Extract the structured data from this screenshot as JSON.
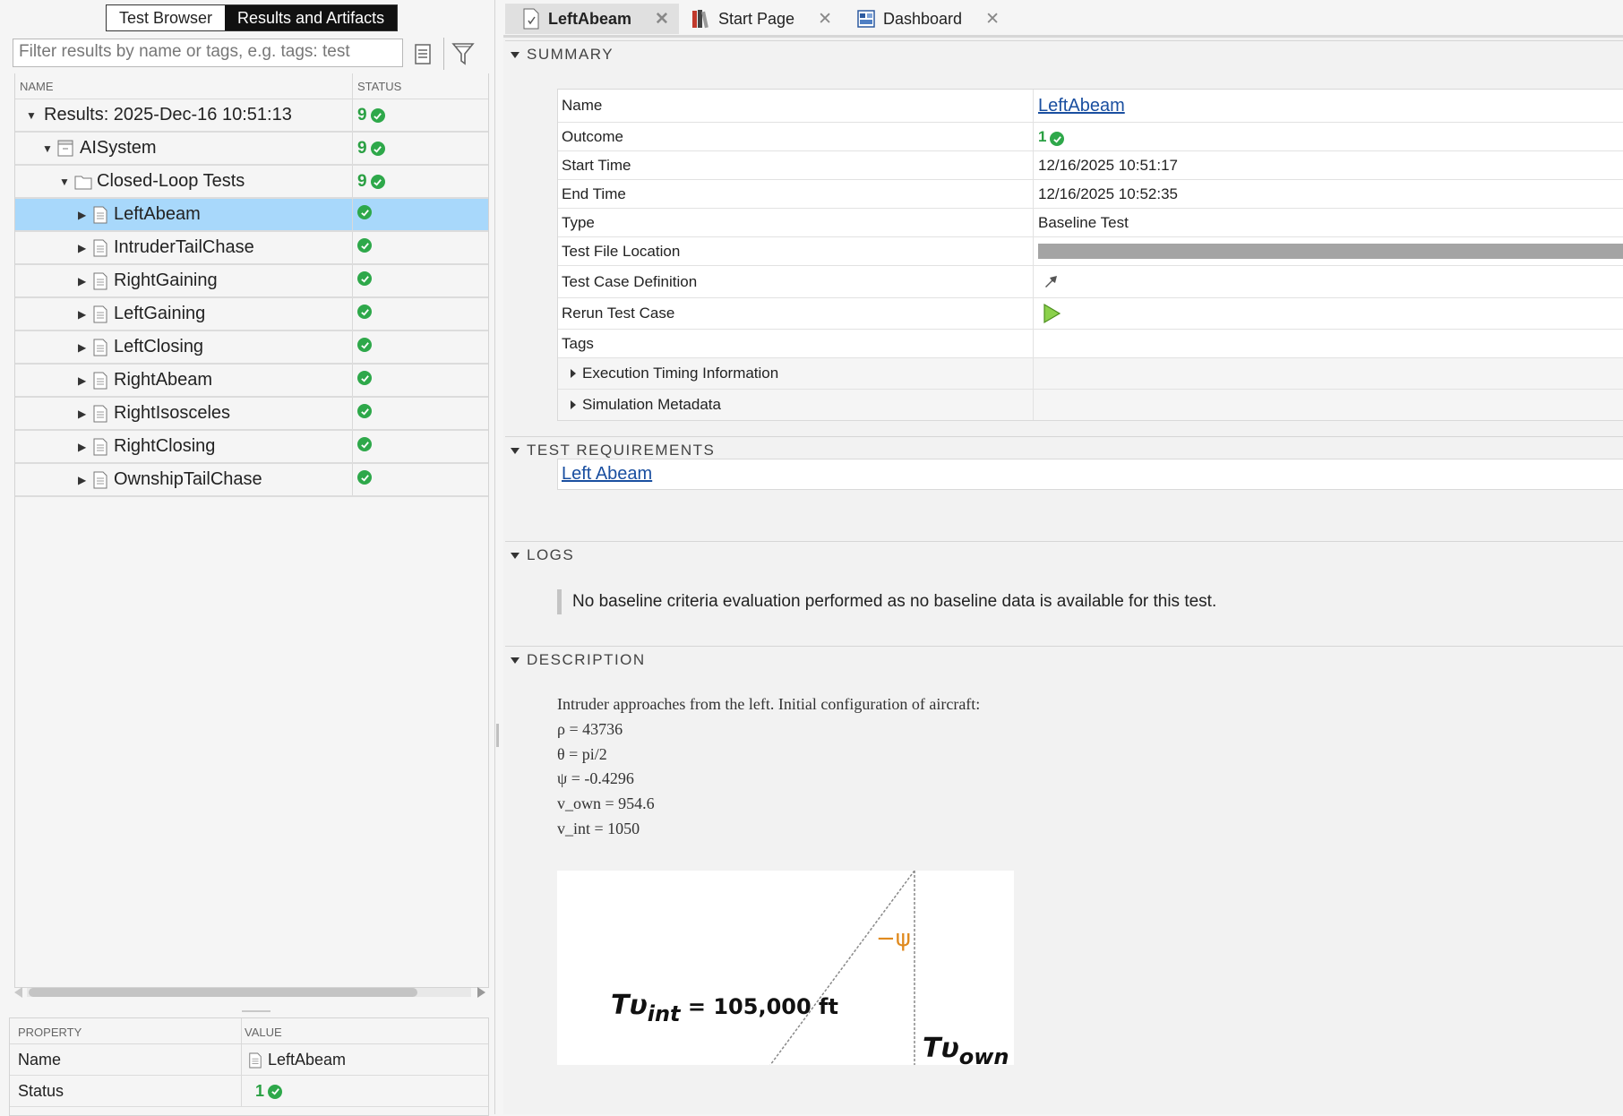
{
  "left_panel": {
    "view_tabs": [
      "Test Browser",
      "Results and Artifacts"
    ],
    "filter_placeholder": "Filter results by name or tags, e.g. tags: test",
    "columns": {
      "name": "NAME",
      "status": "STATUS"
    },
    "tree": [
      {
        "label": "Results: 2025-Dec-16 10:51:13",
        "count": "9"
      },
      {
        "label": "AISystem",
        "count": "9"
      },
      {
        "label": "Closed-Loop Tests",
        "count": "9"
      },
      {
        "label": "LeftAbeam"
      },
      {
        "label": "IntruderTailChase"
      },
      {
        "label": "RightGaining"
      },
      {
        "label": "LeftGaining"
      },
      {
        "label": "LeftClosing"
      },
      {
        "label": "RightAbeam"
      },
      {
        "label": "RightIsosceles"
      },
      {
        "label": "RightClosing"
      },
      {
        "label": "OwnshipTailChase"
      }
    ],
    "properties": {
      "columns": {
        "property": "PROPERTY",
        "value": "VALUE"
      },
      "rows": [
        {
          "key": "Name",
          "value": "LeftAbeam"
        },
        {
          "key": "Status",
          "value": "1"
        }
      ]
    }
  },
  "tabs": [
    {
      "label": "LeftAbeam",
      "icon": "test-case-icon"
    },
    {
      "label": "Start Page",
      "icon": "books-icon"
    },
    {
      "label": "Dashboard",
      "icon": "dashboard-icon"
    }
  ],
  "sections": {
    "summary": "SUMMARY",
    "requirements": "TEST REQUIREMENTS",
    "logs": "LOGS",
    "description": "DESCRIPTION"
  },
  "summary": {
    "name_key": "Name",
    "name_value": "LeftAbeam",
    "outcome_key": "Outcome",
    "outcome_value": "1",
    "start_key": "Start Time",
    "start_value": "12/16/2025 10:51:17",
    "end_key": "End Time",
    "end_value": "12/16/2025 10:52:35",
    "type_key": "Type",
    "type_value": "Baseline Test",
    "location_key": "Test File Location",
    "definition_key": "Test Case Definition",
    "rerun_key": "Rerun Test Case",
    "tags_key": "Tags",
    "timing_key": "Execution Timing Information",
    "metadata_key": "Simulation Metadata"
  },
  "requirement_link": "Left Abeam",
  "log_message": "No baseline criteria evaluation performed as no baseline data is available for this test.",
  "description_lines": [
    "Intruder approaches from the left. Initial configuration of aircraft:",
    "ρ = 43736",
    "θ = pi/2",
    "ψ = -0.4296",
    "v_own = 954.6",
    "v_int = 1050"
  ],
  "diagram": {
    "psi_label": "−ψ",
    "tv_int_label": "Tυ",
    "tv_int_sub": "int",
    "tv_int_value": " = 105,000 ft",
    "tv_own_label": "Tυ",
    "tv_own_sub": "own",
    "tv_own_value": " ="
  },
  "colors": {
    "pass_green": "#2ea84a",
    "selected_row": "#a8d8fb",
    "link": "#1a4fa0",
    "psi_orange": "#e08a1e"
  }
}
